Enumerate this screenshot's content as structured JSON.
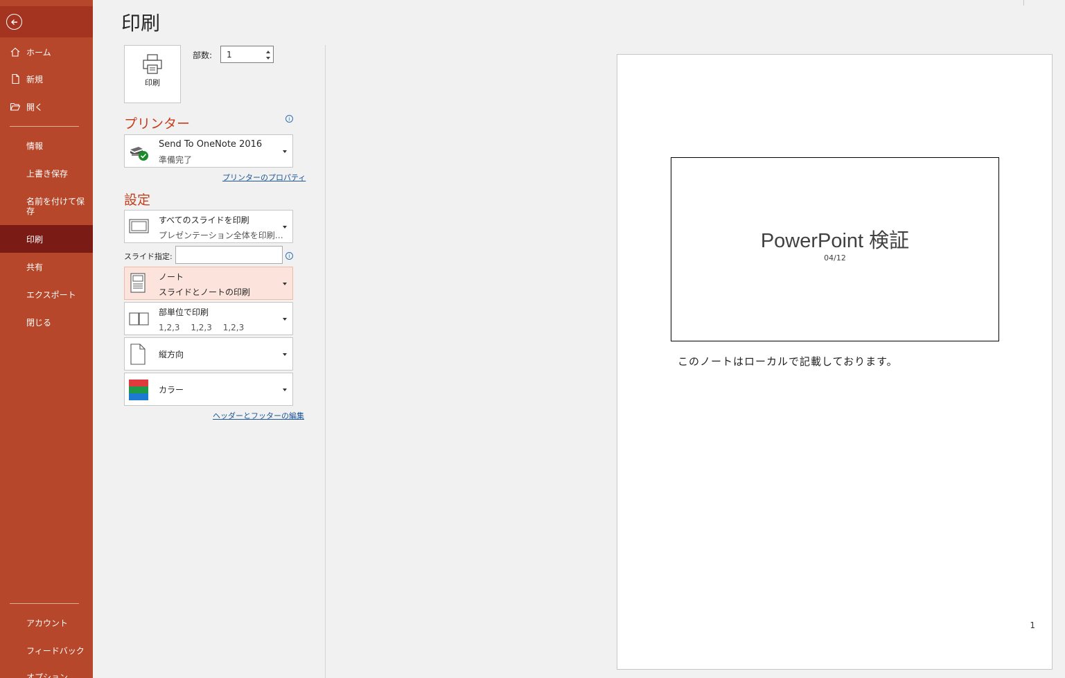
{
  "sidebar": {
    "items": [
      {
        "label": "ホーム",
        "icon": "home-icon"
      },
      {
        "label": "新規",
        "icon": "new-document-icon"
      },
      {
        "label": "開く",
        "icon": "folder-open-icon"
      },
      {
        "label": "情報"
      },
      {
        "label": "上書き保存"
      },
      {
        "label": "名前を付けて保存"
      },
      {
        "label": "印刷",
        "selected": true
      },
      {
        "label": "共有"
      },
      {
        "label": "エクスポート"
      },
      {
        "label": "閉じる"
      }
    ],
    "bottom_items": [
      {
        "label": "アカウント"
      },
      {
        "label": "フィードバック"
      },
      {
        "label": "オプション"
      }
    ]
  },
  "page_title": "印刷",
  "print_button_label": "印刷",
  "copies": {
    "label": "部数:",
    "value": "1"
  },
  "printer": {
    "section_title": "プリンター",
    "name": "Send To OneNote 2016",
    "status": "準備完了",
    "properties_link": "プリンターのプロパティ"
  },
  "settings": {
    "section_title": "設定",
    "range": {
      "main": "すべてのスライドを印刷",
      "sub": "プレゼンテーション全体を印刷…"
    },
    "slide_spec_label": "スライド指定:",
    "slide_spec_value": "",
    "layout": {
      "main": "ノート",
      "sub": "スライドとノートの印刷"
    },
    "collate": {
      "main": "部単位で印刷",
      "sub": "1,2,3　 1,2,3　 1,2,3"
    },
    "orientation": {
      "main": "縦方向"
    },
    "color": {
      "main": "カラー"
    },
    "header_footer_link": "ヘッダーとフッターの編集"
  },
  "preview": {
    "slide_title": "PowerPoint 検証",
    "slide_subtitle": "04/12",
    "notes": "このノートはローカルで記載しております。",
    "page_number": "1"
  },
  "colors": {
    "accent": "#b7472a",
    "selected": "#7a1b15",
    "section_title": "#c43e1c"
  }
}
